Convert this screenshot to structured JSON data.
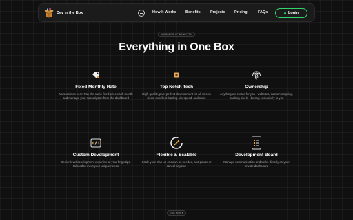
{
  "nav": {
    "brand": "Dev in the Box",
    "links": [
      "How It Works",
      "Benefits",
      "Projects",
      "Pricing",
      "FAQs"
    ],
    "login_label": "Login",
    "accent": "#33d46e"
  },
  "section": {
    "badge": "MEMBERSHIP BENEFITS",
    "title": "Everything in One Box",
    "next_badge": "OUR WORK"
  },
  "features": [
    {
      "icon": "tag-icon",
      "title": "Fixed Monthly Rate",
      "desc": "No surprises here! Pay the same fixed price each month and manage your subscription from the dashboard"
    },
    {
      "icon": "chip-icon",
      "title": "Top Notch Tech",
      "desc": "High-quality, pixel perfect development for all screen sizes, excellent loading site speed, and more"
    },
    {
      "icon": "fingerprint-icon",
      "title": "Ownership",
      "desc": "Anything we create for you - websites, custom scripting, tracking pixels - belong exclusively to you"
    },
    {
      "icon": "code-icon",
      "title": "Custom Development",
      "desc": "Senior-level development expertise at your fingertips, tailored to meet your unique needs"
    },
    {
      "icon": "refresh-icon",
      "title": "Flexible & Scalable",
      "desc": "Scale your plan up or down as needed, and pause or cancel anytime"
    },
    {
      "icon": "board-icon",
      "title": "Development Board",
      "desc": "Manage communication and tasks directly on your private dashboard"
    }
  ]
}
